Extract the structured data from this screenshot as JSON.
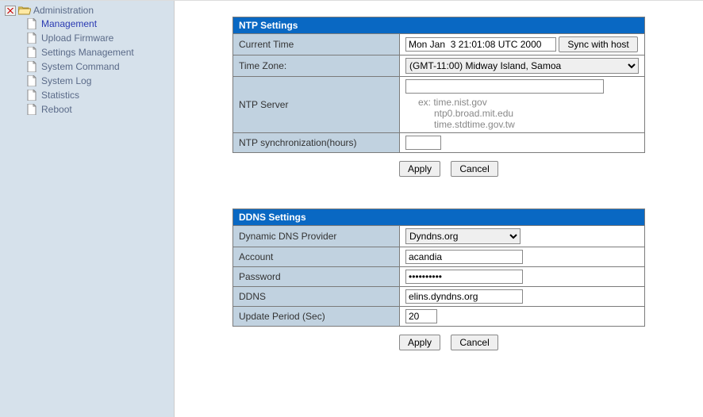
{
  "sidebar": {
    "root_label": "Administration",
    "items": [
      {
        "label": "Management",
        "active": true
      },
      {
        "label": "Upload Firmware"
      },
      {
        "label": "Settings Management"
      },
      {
        "label": "System Command"
      },
      {
        "label": "System Log"
      },
      {
        "label": "Statistics"
      },
      {
        "label": "Reboot"
      }
    ]
  },
  "ntp": {
    "header": "NTP Settings",
    "current_time_label": "Current Time",
    "current_time_value": "Mon Jan  3 21:01:08 UTC 2000",
    "sync_button": "Sync with host",
    "time_zone_label": "Time Zone:",
    "time_zone_value": "(GMT-11:00) Midway Island, Samoa",
    "ntp_server_label": "NTP Server",
    "ntp_server_value": "",
    "ntp_server_examples": "ex: time.nist.gov\n      ntp0.broad.mit.edu\n      time.stdtime.gov.tw",
    "ntp_sync_label": "NTP synchronization(hours)",
    "ntp_sync_value": "",
    "apply": "Apply",
    "cancel": "Cancel"
  },
  "ddns": {
    "header": "DDNS Settings",
    "provider_label": "Dynamic DNS Provider",
    "provider_value": "Dyndns.org",
    "account_label": "Account",
    "account_value": "acandia",
    "password_label": "Password",
    "password_value": "••••••••••",
    "ddns_label": "DDNS",
    "ddns_value": "elins.dyndns.org",
    "update_label": "Update Period (Sec)",
    "update_value": "20",
    "apply": "Apply",
    "cancel": "Cancel"
  }
}
